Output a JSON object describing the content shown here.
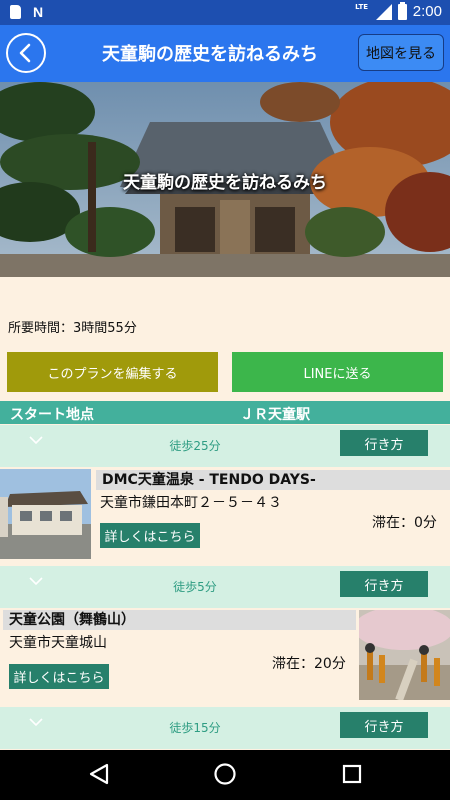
{
  "status_bar": {
    "time": "2:00",
    "network": "LTE",
    "icons": [
      "sd-card-icon",
      "n-icon",
      "signal-icon",
      "battery-icon"
    ]
  },
  "app_bar": {
    "title": "天童駒の歴史を訪ねるみち",
    "map_button": "地図を見る",
    "back_icon": "back-arrow-icon"
  },
  "hero": {
    "title": "天童駒の歴史を訪ねるみち"
  },
  "plan": {
    "duration": "所要時間：3時間55分",
    "edit_button": "このプランを編集する",
    "line_button": "LINEに送る"
  },
  "start": {
    "label": "スタート地点",
    "value": "ＪＲ天童駅"
  },
  "steps": [
    {
      "walk": "徒歩25分",
      "route_button": "行き方"
    },
    {
      "walk": "徒歩5分",
      "route_button": "行き方"
    },
    {
      "walk": "徒歩15分",
      "route_button": "行き方"
    }
  ],
  "spots": [
    {
      "name": "DMC天童温泉 - TENDO DAYS-",
      "address": "天童市鎌田本町２－５－４３",
      "stay": "滞在：0分",
      "detail_button": "詳しくはこちら"
    },
    {
      "name": "天童公園（舞鶴山）",
      "address": "天童市天童城山",
      "stay": "滞在：20分",
      "detail_button": "詳しくはこちら"
    }
  ],
  "colors": {
    "status_bar": "#1d4fb0",
    "app_bar": "#2b76ee",
    "accent_green": "#27806b",
    "teal": "#43b09c",
    "line_green": "#3cb64b",
    "olive": "#a09a0b",
    "background": "#fdf1e1"
  },
  "nav_bar": {
    "icons": [
      "back-triangle-icon",
      "home-circle-icon",
      "recents-square-icon"
    ]
  }
}
